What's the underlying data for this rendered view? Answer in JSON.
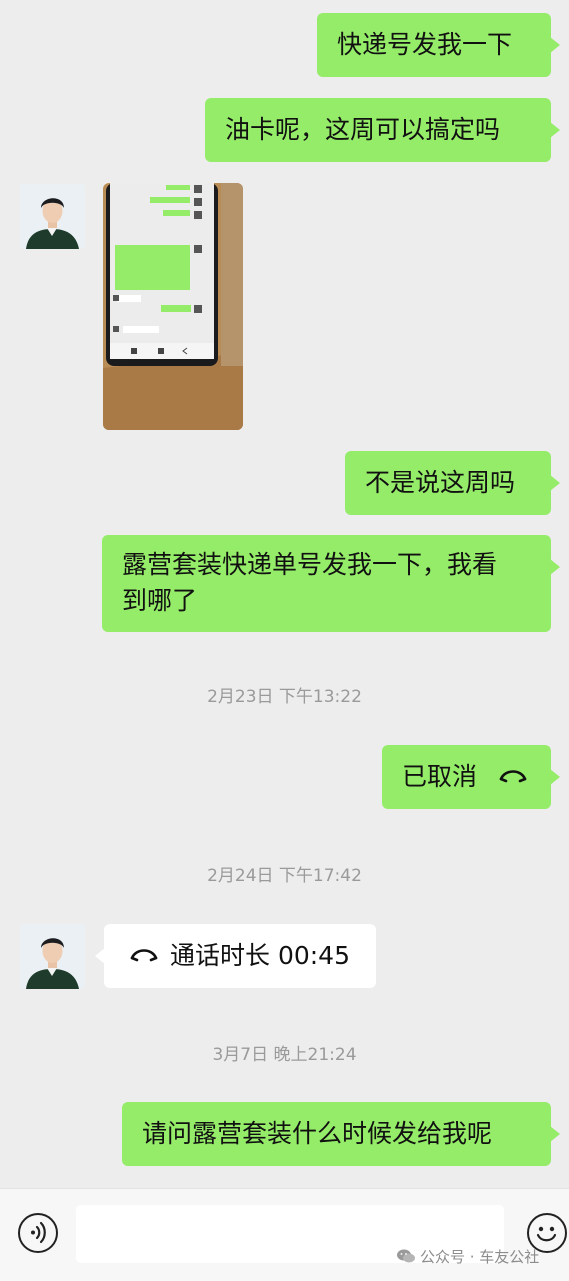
{
  "messages": {
    "m1": "快递号发我一下",
    "m2": "油卡呢，这周可以搞定吗",
    "m3": "不是说这周吗",
    "m4_line1": "露营套装快递单号发我一下，我看",
    "m4_line2": "到哪了",
    "m5": "已取消",
    "m6": "通话时长 00:45",
    "m7": "请问露营套装什么时候发给我呢"
  },
  "timestamps": {
    "t1": "2月23日 下午13:22",
    "t2": "2月24日 下午17:42",
    "t3": "3月7日 晚上21:24"
  },
  "watermark": {
    "text": "公众号 · 车友公社"
  },
  "colors": {
    "outgoing_bubble": "#95ec69",
    "incoming_bubble": "#ffffff",
    "background": "#ededed"
  },
  "icons": [
    "hang-up-icon",
    "voice-input-icon",
    "emoji-icon",
    "wechat-icon"
  ]
}
